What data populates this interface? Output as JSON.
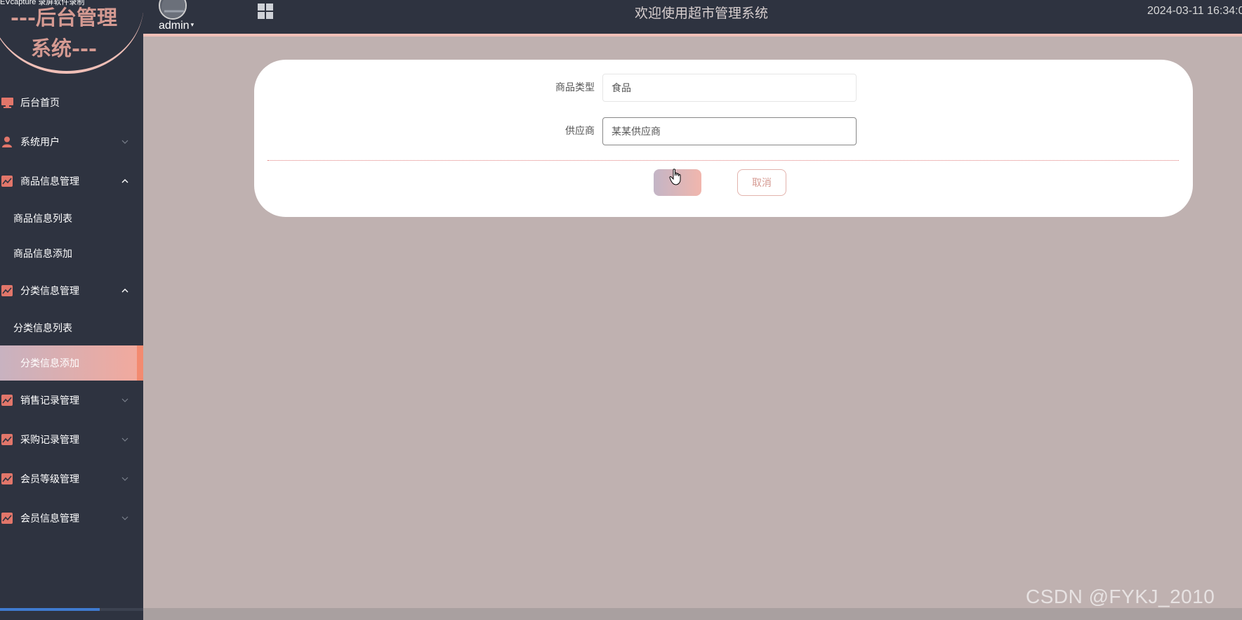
{
  "recorder_overlay": "EVcapture 录屏软件录制",
  "logo": {
    "line1": "---后台管理",
    "line2": "系统---"
  },
  "header": {
    "username": "admin",
    "caret": "▾",
    "welcome": "欢迎使用超市管理系统",
    "datetime": "2024-03-11 16:34:0"
  },
  "colors": {
    "sidebar_bg": "#2e3340",
    "accent": "#f0bfb7",
    "icon": "#e2766a",
    "content_bg": "#bfb1b0"
  },
  "sidebar": {
    "home": {
      "label": "后台首页",
      "icon": "monitor-icon"
    },
    "system_users": {
      "label": "系统用户",
      "icon": "user-icon",
      "state": "collapsed"
    },
    "product_mgmt": {
      "label": "商品信息管理",
      "icon": "chart-icon",
      "state": "expanded",
      "children": [
        "商品信息列表",
        "商品信息添加"
      ]
    },
    "category_mgmt": {
      "label": "分类信息管理",
      "icon": "chart-icon",
      "state": "expanded",
      "children": [
        "分类信息列表",
        "分类信息添加"
      ],
      "active_child": "分类信息添加"
    },
    "sales_mgmt": {
      "label": "销售记录管理",
      "icon": "chart-icon",
      "state": "collapsed"
    },
    "purchase_mgmt": {
      "label": "采购记录管理",
      "icon": "chart-icon",
      "state": "collapsed"
    },
    "member_level_mgmt": {
      "label": "会员等级管理",
      "icon": "chart-icon",
      "state": "collapsed"
    },
    "member_info_mgmt": {
      "label": "会员信息管理",
      "icon": "chart-icon",
      "state": "collapsed"
    }
  },
  "form": {
    "fields": [
      {
        "label": "商品类型",
        "value": "食品"
      },
      {
        "label": "供应商",
        "value": "某某供应商"
      }
    ],
    "cancel_label": "取消"
  },
  "watermark": "CSDN @FYKJ_2010"
}
